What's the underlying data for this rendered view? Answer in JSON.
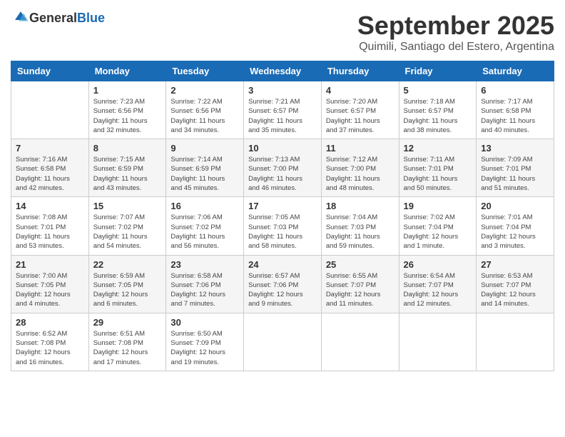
{
  "header": {
    "logo": {
      "general": "General",
      "blue": "Blue"
    },
    "title": "September 2025",
    "subtitle": "Quimili, Santiago del Estero, Argentina"
  },
  "calendar": {
    "days_of_week": [
      "Sunday",
      "Monday",
      "Tuesday",
      "Wednesday",
      "Thursday",
      "Friday",
      "Saturday"
    ],
    "weeks": [
      [
        {
          "day": "",
          "info": ""
        },
        {
          "day": "1",
          "info": "Sunrise: 7:23 AM\nSunset: 6:56 PM\nDaylight: 11 hours\nand 32 minutes."
        },
        {
          "day": "2",
          "info": "Sunrise: 7:22 AM\nSunset: 6:56 PM\nDaylight: 11 hours\nand 34 minutes."
        },
        {
          "day": "3",
          "info": "Sunrise: 7:21 AM\nSunset: 6:57 PM\nDaylight: 11 hours\nand 35 minutes."
        },
        {
          "day": "4",
          "info": "Sunrise: 7:20 AM\nSunset: 6:57 PM\nDaylight: 11 hours\nand 37 minutes."
        },
        {
          "day": "5",
          "info": "Sunrise: 7:18 AM\nSunset: 6:57 PM\nDaylight: 11 hours\nand 38 minutes."
        },
        {
          "day": "6",
          "info": "Sunrise: 7:17 AM\nSunset: 6:58 PM\nDaylight: 11 hours\nand 40 minutes."
        }
      ],
      [
        {
          "day": "7",
          "info": "Sunrise: 7:16 AM\nSunset: 6:58 PM\nDaylight: 11 hours\nand 42 minutes."
        },
        {
          "day": "8",
          "info": "Sunrise: 7:15 AM\nSunset: 6:59 PM\nDaylight: 11 hours\nand 43 minutes."
        },
        {
          "day": "9",
          "info": "Sunrise: 7:14 AM\nSunset: 6:59 PM\nDaylight: 11 hours\nand 45 minutes."
        },
        {
          "day": "10",
          "info": "Sunrise: 7:13 AM\nSunset: 7:00 PM\nDaylight: 11 hours\nand 46 minutes."
        },
        {
          "day": "11",
          "info": "Sunrise: 7:12 AM\nSunset: 7:00 PM\nDaylight: 11 hours\nand 48 minutes."
        },
        {
          "day": "12",
          "info": "Sunrise: 7:11 AM\nSunset: 7:01 PM\nDaylight: 11 hours\nand 50 minutes."
        },
        {
          "day": "13",
          "info": "Sunrise: 7:09 AM\nSunset: 7:01 PM\nDaylight: 11 hours\nand 51 minutes."
        }
      ],
      [
        {
          "day": "14",
          "info": "Sunrise: 7:08 AM\nSunset: 7:01 PM\nDaylight: 11 hours\nand 53 minutes."
        },
        {
          "day": "15",
          "info": "Sunrise: 7:07 AM\nSunset: 7:02 PM\nDaylight: 11 hours\nand 54 minutes."
        },
        {
          "day": "16",
          "info": "Sunrise: 7:06 AM\nSunset: 7:02 PM\nDaylight: 11 hours\nand 56 minutes."
        },
        {
          "day": "17",
          "info": "Sunrise: 7:05 AM\nSunset: 7:03 PM\nDaylight: 11 hours\nand 58 minutes."
        },
        {
          "day": "18",
          "info": "Sunrise: 7:04 AM\nSunset: 7:03 PM\nDaylight: 11 hours\nand 59 minutes."
        },
        {
          "day": "19",
          "info": "Sunrise: 7:02 AM\nSunset: 7:04 PM\nDaylight: 12 hours\nand 1 minute."
        },
        {
          "day": "20",
          "info": "Sunrise: 7:01 AM\nSunset: 7:04 PM\nDaylight: 12 hours\nand 3 minutes."
        }
      ],
      [
        {
          "day": "21",
          "info": "Sunrise: 7:00 AM\nSunset: 7:05 PM\nDaylight: 12 hours\nand 4 minutes."
        },
        {
          "day": "22",
          "info": "Sunrise: 6:59 AM\nSunset: 7:05 PM\nDaylight: 12 hours\nand 6 minutes."
        },
        {
          "day": "23",
          "info": "Sunrise: 6:58 AM\nSunset: 7:06 PM\nDaylight: 12 hours\nand 7 minutes."
        },
        {
          "day": "24",
          "info": "Sunrise: 6:57 AM\nSunset: 7:06 PM\nDaylight: 12 hours\nand 9 minutes."
        },
        {
          "day": "25",
          "info": "Sunrise: 6:55 AM\nSunset: 7:07 PM\nDaylight: 12 hours\nand 11 minutes."
        },
        {
          "day": "26",
          "info": "Sunrise: 6:54 AM\nSunset: 7:07 PM\nDaylight: 12 hours\nand 12 minutes."
        },
        {
          "day": "27",
          "info": "Sunrise: 6:53 AM\nSunset: 7:07 PM\nDaylight: 12 hours\nand 14 minutes."
        }
      ],
      [
        {
          "day": "28",
          "info": "Sunrise: 6:52 AM\nSunset: 7:08 PM\nDaylight: 12 hours\nand 16 minutes."
        },
        {
          "day": "29",
          "info": "Sunrise: 6:51 AM\nSunset: 7:08 PM\nDaylight: 12 hours\nand 17 minutes."
        },
        {
          "day": "30",
          "info": "Sunrise: 6:50 AM\nSunset: 7:09 PM\nDaylight: 12 hours\nand 19 minutes."
        },
        {
          "day": "",
          "info": ""
        },
        {
          "day": "",
          "info": ""
        },
        {
          "day": "",
          "info": ""
        },
        {
          "day": "",
          "info": ""
        }
      ]
    ]
  }
}
